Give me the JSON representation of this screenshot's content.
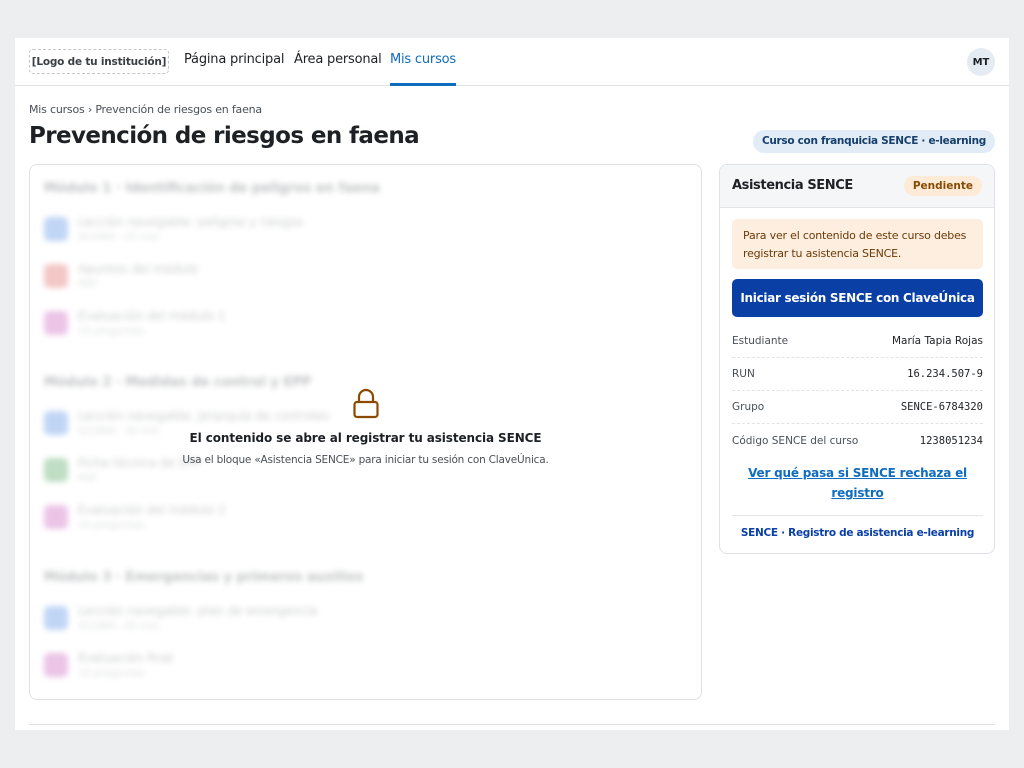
{
  "navbar": {
    "logo_text": "[Logo de tu institución]",
    "links": [
      {
        "label": "Página principal"
      },
      {
        "label": "Área personal"
      },
      {
        "label": "Mis cursos"
      }
    ],
    "active_link": "Mis cursos",
    "user_initials": "MT"
  },
  "header": {
    "breadcrumb": [
      "Mis cursos",
      "Prevención de riesgos en faena"
    ],
    "breadcrumb_separator": "›",
    "title": "Prevención de riesgos en faena",
    "badge": "Curso con franquicia SENCE · e-learning"
  },
  "course": {
    "modules": [
      {
        "title": "Módulo 1 · Identificación de peligros en faena",
        "activities": [
          {
            "name": "Lección navegable: peligros y riesgos",
            "meta": "SCORM · 25 min",
            "icon_color": "#3f7fe0"
          },
          {
            "name": "Apuntes del módulo",
            "meta": "PDF",
            "icon_color": "#d9534f"
          },
          {
            "name": "Evaluación del módulo 1",
            "meta": "10 preguntas",
            "icon_color": "#c44bb3"
          }
        ]
      },
      {
        "title": "Módulo 2 · Medidas de control y EPP",
        "activities": [
          {
            "name": "Lección navegable: jerarquía de controles",
            "meta": "SCORM · 30 min",
            "icon_color": "#3f7fe0"
          },
          {
            "name": "Ficha técnica de EPP",
            "meta": "PDF",
            "icon_color": "#3a9a4a"
          },
          {
            "name": "Evaluación del módulo 2",
            "meta": "10 preguntas",
            "icon_color": "#c44bb3"
          }
        ]
      },
      {
        "title": "Módulo 3 · Emergencias y primeros auxilios",
        "activities": [
          {
            "name": "Lección navegable: plan de emergencia",
            "meta": "SCORM · 20 min",
            "icon_color": "#3f7fe0"
          },
          {
            "name": "Evaluación final",
            "meta": "15 preguntas",
            "icon_color": "#c44bb3"
          }
        ]
      }
    ],
    "lock": {
      "title": "El contenido se abre al registrar tu asistencia SENCE",
      "subtitle": "Usa el bloque «Asistencia SENCE» para iniciar tu sesión con ClaveÚnica.",
      "icon": "padlock-icon",
      "icon_color": "#8a4a00"
    }
  },
  "sence": {
    "title": "Asistencia SENCE",
    "status": "Pendiente",
    "alert": "Para ver el contenido de este curso debes registrar tu asistencia SENCE.",
    "login_button": "Iniciar sesión SENCE con ClaveÚnica",
    "rows": [
      {
        "label": "Estudiante",
        "value": "María Tapia Rojas"
      },
      {
        "label": "RUN",
        "value": "16.234.507-9"
      },
      {
        "label": "Grupo",
        "value": "SENCE-6784320"
      },
      {
        "label": "Código SENCE del curso",
        "value": "1238051234"
      }
    ],
    "reject_link": "Ver qué pasa si SENCE rechaza el registro",
    "footer": "SENCE · Registro de asistencia e-learning"
  },
  "colors": {
    "accent": "#0f6cbf",
    "sence_blue": "#0a3fa6",
    "pending_bg": "#fdebd8",
    "pending_text": "#8a4a00"
  }
}
